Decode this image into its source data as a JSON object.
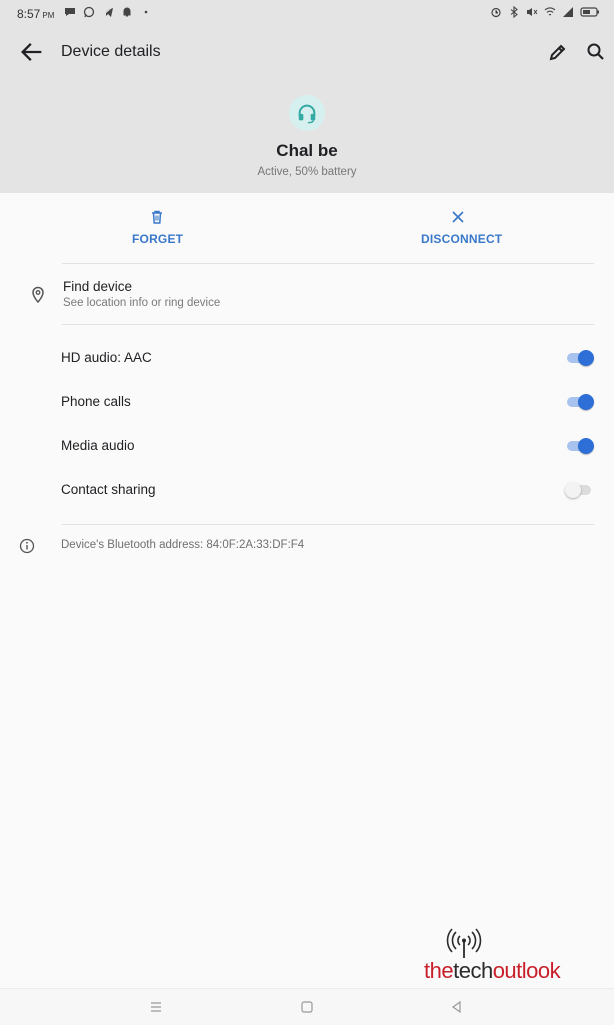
{
  "status_bar": {
    "time": "8:57",
    "ampm": "PM",
    "left_icons": [
      "chat-icon",
      "whatsapp-icon",
      "telegram-icon",
      "notification-icon",
      "dot-icon"
    ],
    "right_icons": [
      "alarm-icon",
      "bluetooth-icon",
      "mute-icon",
      "wifi-icon",
      "signal-icon",
      "battery-icon"
    ]
  },
  "app_bar": {
    "title": "Device details",
    "back_icon": "arrow-back-icon",
    "edit_icon": "pencil-icon",
    "search_icon": "search-icon"
  },
  "device": {
    "icon": "headset-icon",
    "name": "Chal be",
    "status": "Active, 50% battery",
    "icon_color": "#35a9a4"
  },
  "actions": [
    {
      "label": "FORGET",
      "icon": "trash-icon"
    },
    {
      "label": "DISCONNECT",
      "icon": "close-icon"
    }
  ],
  "find_device": {
    "title": "Find device",
    "subtitle": "See location info or ring device",
    "icon": "location-pin-icon"
  },
  "toggles": [
    {
      "label": "HD audio: AAC",
      "on": true
    },
    {
      "label": "Phone calls",
      "on": true
    },
    {
      "label": "Media audio",
      "on": true
    },
    {
      "label": "Contact sharing",
      "on": false
    }
  ],
  "bluetooth_info": {
    "text": "Device's Bluetooth address: 84:0F:2A:33:DF:F4",
    "icon": "info-icon"
  },
  "watermark": {
    "part1": "the",
    "part2": "tech",
    "part3": "outlook"
  },
  "nav_bar": {
    "icons": [
      "menu-icon",
      "home-icon",
      "back-triangle-icon"
    ]
  },
  "colors": {
    "accent": "#3a78c9",
    "switch_on": "#2d6fd6",
    "header_bg": "#e4e4e4",
    "background": "#fafafa"
  }
}
